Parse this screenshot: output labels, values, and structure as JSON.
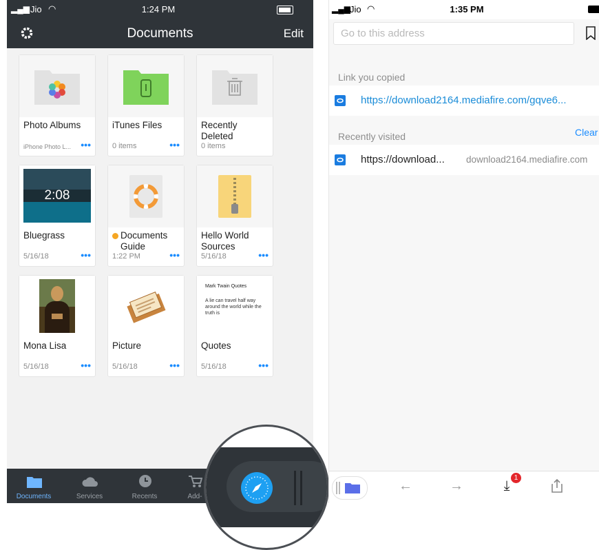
{
  "left_screen": {
    "status": {
      "carrier": "Jio",
      "time": "1:24 PM"
    },
    "navbar": {
      "title": "Documents",
      "edit_label": "Edit"
    },
    "items": [
      {
        "title": "Photo Albums",
        "subtitle": "iPhone Photo L...",
        "icon": "photos-folder-icon"
      },
      {
        "title": "iTunes Files",
        "subtitle": "0 items",
        "icon": "itunes-folder-icon"
      },
      {
        "title": "Recently Deleted",
        "subtitle": "0 items",
        "icon": "trash-folder-icon"
      },
      {
        "title": "Bluegrass",
        "subtitle": "5/16/18",
        "video_duration": "2:08",
        "icon": "video-thumbnail"
      },
      {
        "title": "Documents Guide",
        "subtitle": "1:22 PM",
        "icon": "lifebuoy-icon",
        "unread_dot_color": "#f5a623"
      },
      {
        "title": "Hello World Sources",
        "subtitle": "5/16/18",
        "icon": "zip-archive-icon"
      },
      {
        "title": "Mona Lisa",
        "subtitle": "5/16/18",
        "icon": "mona-lisa-thumbnail"
      },
      {
        "title": "Picture",
        "subtitle": "5/16/18",
        "icon": "picture-thumbnail"
      },
      {
        "title": "Quotes",
        "subtitle": "5/16/18",
        "icon": "text-document-thumbnail",
        "preview_title": "Mark Twain Quotes",
        "preview_body": "A lie can travel half way around the world while the truth is"
      }
    ],
    "tabs": [
      {
        "label": "Documents",
        "icon": "folder-icon",
        "active": true
      },
      {
        "label": "Services",
        "icon": "cloud-icon",
        "active": false
      },
      {
        "label": "Recents",
        "icon": "clock-icon",
        "active": false
      },
      {
        "label": "Add-",
        "icon": "cart-icon",
        "active": false
      }
    ],
    "more_icon": "ellipsis-icon"
  },
  "zoom": {
    "icon": "compass-icon"
  },
  "right_screen": {
    "status": {
      "carrier": "Jio",
      "time": "1:35 PM"
    },
    "address_placeholder": "Go to this address",
    "copied_header": "Link you copied",
    "copied_link": "https://download2164.mediafire.com/gqve6...",
    "recent_header": "Recently visited",
    "clear_label": "Clear",
    "recent_title": "https://download...",
    "recent_domain": "download2164.mediafire.com",
    "download_badge": "1"
  },
  "colors": {
    "dark_bar": "#2f3439",
    "accent": "#1a8cff",
    "folder_green": "#7fd35b",
    "badge_red": "#e3262b"
  }
}
